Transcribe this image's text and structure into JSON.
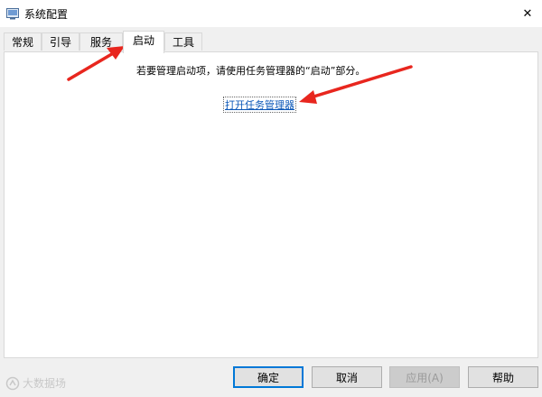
{
  "window": {
    "title": "系统配置",
    "close_glyph": "✕"
  },
  "tabs": [
    {
      "label": "常规",
      "active": false
    },
    {
      "label": "引导",
      "active": false
    },
    {
      "label": "服务",
      "active": false
    },
    {
      "label": "启动",
      "active": true
    },
    {
      "label": "工具",
      "active": false
    }
  ],
  "startup": {
    "info_text": "若要管理启动项，请使用任务管理器的“启动”部分。",
    "link_text": "打开任务管理器"
  },
  "buttons": {
    "ok": "确定",
    "cancel": "取消",
    "apply": "应用(A)",
    "help": "帮助"
  },
  "watermark": {
    "text": "大数据场"
  },
  "colors": {
    "annotation_arrow": "#e8261e",
    "link": "#0b57b8",
    "default_button_border": "#0078d7"
  }
}
